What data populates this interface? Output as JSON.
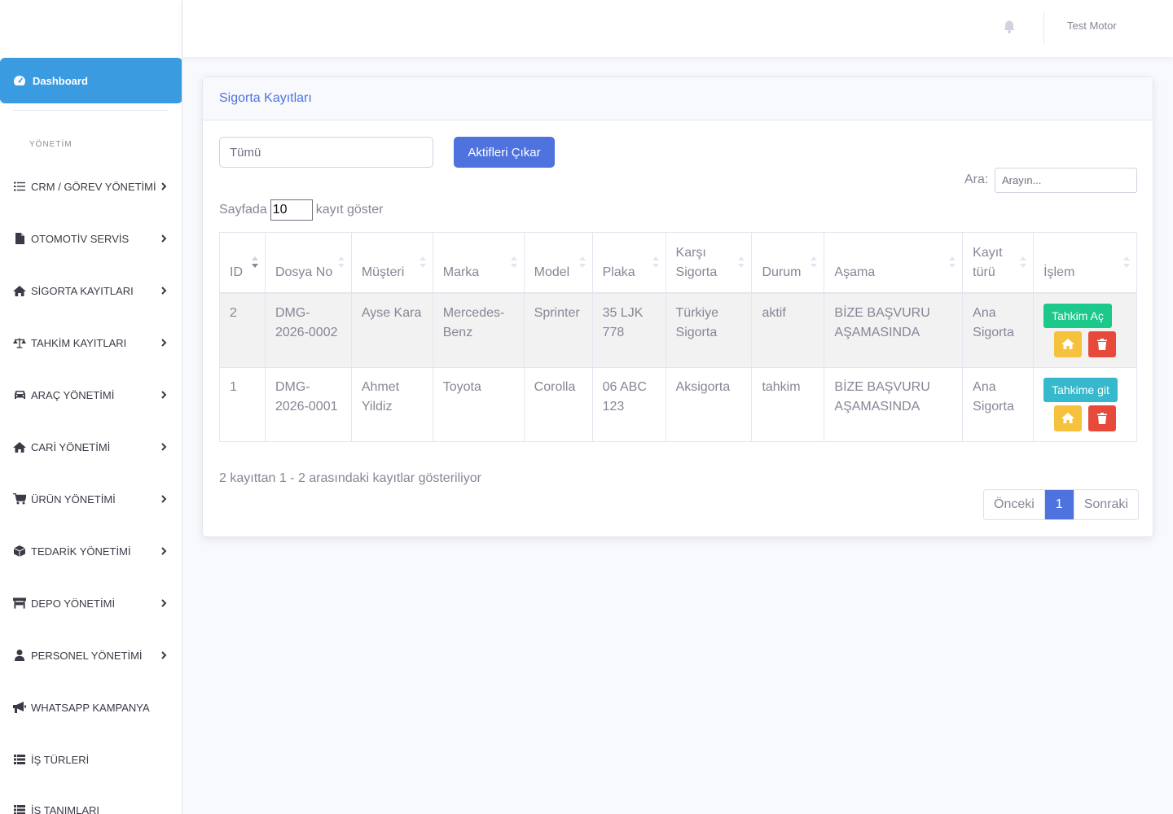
{
  "sidebar": {
    "dashboard_label": "Dashboard",
    "section_heading": "YÖNETİM",
    "items": [
      {
        "label": "CRM / GÖREV YÖNETİMİ",
        "icon": "list-check-icon",
        "has_chevron": true
      },
      {
        "label": "OTOMOTİV SERVİS",
        "icon": "file-icon",
        "has_chevron": true
      },
      {
        "label": "SİGORTA KAYITLARI",
        "icon": "home-icon",
        "has_chevron": true
      },
      {
        "label": "TAHKİM KAYITLARI",
        "icon": "balance-scale-icon",
        "has_chevron": true
      },
      {
        "label": "ARAÇ YÖNETİMİ",
        "icon": "car-icon",
        "has_chevron": true
      },
      {
        "label": "CARİ YÖNETİMİ",
        "icon": "home-icon",
        "has_chevron": true
      },
      {
        "label": "ÜRÜN YÖNETİMİ",
        "icon": "cart-icon",
        "has_chevron": true
      },
      {
        "label": "TEDARİK YÖNETİMİ",
        "icon": "box-icon",
        "has_chevron": true
      },
      {
        "label": "DEPO YÖNETİMİ",
        "icon": "store-icon",
        "has_chevron": true
      },
      {
        "label": "PERSONEL YÖNETİMİ",
        "icon": "user-icon",
        "has_chevron": true
      },
      {
        "label": "WHATSAPP KAMPANYA",
        "icon": "bullhorn-icon",
        "has_chevron": false
      },
      {
        "label": "İŞ TÜRLERİ",
        "icon": "table-list-icon",
        "has_chevron": false
      },
      {
        "label": "İŞ TANIMLARI",
        "icon": "table-list-icon",
        "has_chevron": false
      }
    ]
  },
  "topbar": {
    "user_name": "Test Motor",
    "notification_icon": "bell-icon"
  },
  "card": {
    "title": "Sigorta Kayıtları",
    "filter_value": "Tümü",
    "export_button": "Aktifleri Çıkar",
    "search_label": "Ara:",
    "search_placeholder": "Arayın...",
    "length_prefix": "Sayfada",
    "length_value": "10",
    "length_suffix": "kayıt göster",
    "columns": [
      "ID",
      "Dosya No",
      "Müşteri",
      "Marka",
      "Model",
      "Plaka",
      "Karşı Sigorta",
      "Durum",
      "Aşama",
      "Kayıt türü",
      "İşlem"
    ],
    "rows": [
      {
        "id": "2",
        "dosya_no": "DMG-2026-0002",
        "musteri": "Ayse Kara",
        "marka": "Mercedes-Benz",
        "model": "Sprinter",
        "plaka": "35 LJK 778",
        "karsi_sigorta": "Türkiye Sigorta",
        "durum": "aktif",
        "asama": "BİZE BAŞVURU AŞAMASINDA",
        "kayit_turu": "Ana Sigorta",
        "action_label": "Tahkim Aç",
        "action_color": "#1cc88a"
      },
      {
        "id": "1",
        "dosya_no": "DMG-2026-0001",
        "musteri": "Ahmet Yildiz",
        "marka": "Toyota",
        "model": "Corolla",
        "plaka": "06 ABC 123",
        "karsi_sigorta": "Aksigorta",
        "durum": "tahkim",
        "asama": "BİZE BAŞVURU AŞAMASINDA",
        "kayit_turu": "Ana Sigorta",
        "action_label": "Tahkime git",
        "action_color": "#36b9cc"
      }
    ],
    "info_text": "2 kayıttan 1 - 2 arasındaki kayıtlar gösteriliyor",
    "pagination": {
      "prev": "Önceki",
      "current": "1",
      "next": "Sonraki"
    }
  },
  "colors": {
    "primary": "#4e73df",
    "sidebar_active": "#3a9be0",
    "success": "#1cc88a",
    "info": "#36b9cc",
    "warning": "#f6c23e",
    "danger": "#e74a3b"
  }
}
